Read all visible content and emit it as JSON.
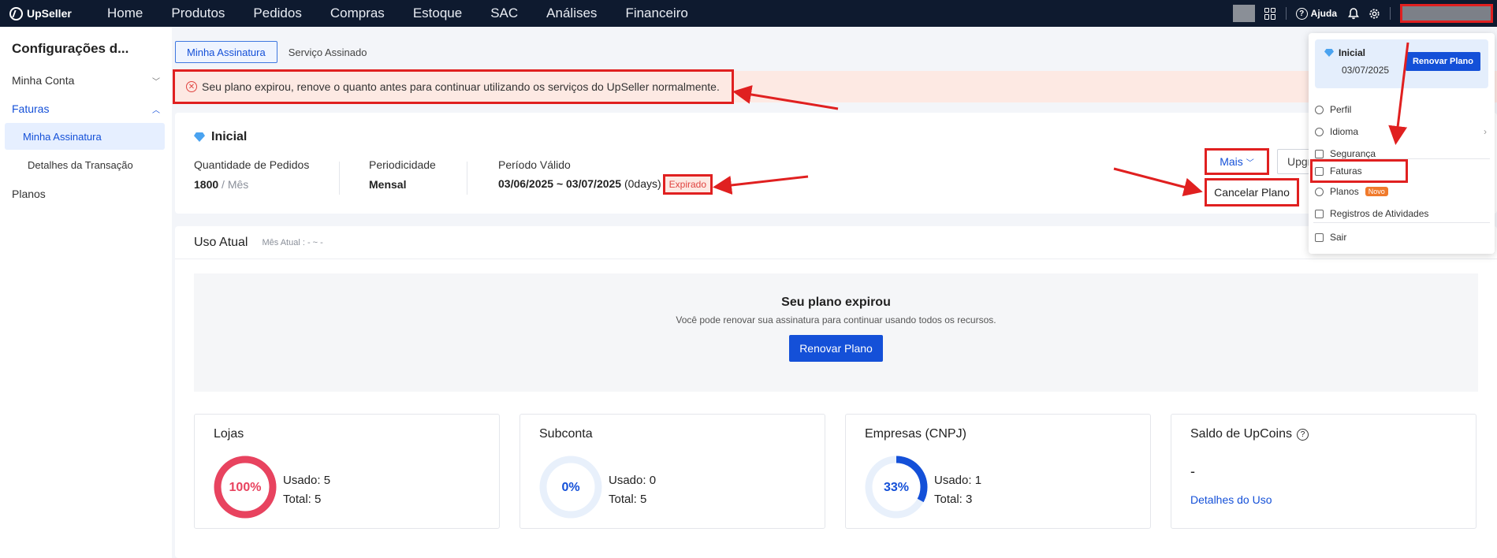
{
  "app": {
    "name": "UpSeller"
  },
  "nav": {
    "items": [
      "Home",
      "Produtos",
      "Pedidos",
      "Compras",
      "Estoque",
      "SAC",
      "Análises",
      "Financeiro"
    ]
  },
  "topbar": {
    "help_label": "Ajuda"
  },
  "sidebar": {
    "title": "Configurações d...",
    "minha_conta": "Minha Conta",
    "faturas": "Faturas",
    "minha_assinatura": "Minha Assinatura",
    "detalhes_transacao": "Detalhes da Transação",
    "planos": "Planos"
  },
  "tabs": {
    "active": "Minha Assinatura",
    "other": "Serviço Assinado"
  },
  "alert": {
    "text": "Seu plano expirou, renove o quanto antes para continuar utilizando os serviços do UpSeller normalmente."
  },
  "plan": {
    "name": "Inicial",
    "qty_label": "Quantidade de Pedidos",
    "qty_value": "1800",
    "qty_unit": " / Mês",
    "period_label": "Periodicidade",
    "period_value": "Mensal",
    "valid_label": "Período Válido",
    "valid_value": "03/06/2025 ~ 03/07/2025",
    "valid_days": " (0days)",
    "status_badge": "Expirado",
    "more_button": "Mais",
    "upgrade_button": "Upgrade",
    "cancel_option": "Cancelar Plano"
  },
  "usage": {
    "title": "Uso Atual",
    "month_label": "Mês Atual : - ~ -",
    "expired_title": "Seu plano expirou",
    "expired_sub": "Você pode renovar sua assinatura para continuar usando todos os recursos.",
    "renew_button": "Renovar Plano"
  },
  "cards": {
    "lojas": {
      "title": "Lojas",
      "percent_label": "100%",
      "percent": 1.0,
      "used": "Usado: 5",
      "total": "Total: 5",
      "color": "#e8435f"
    },
    "subconta": {
      "title": "Subconta",
      "percent_label": "0%",
      "percent": 0.0,
      "used": "Usado: 0",
      "total": "Total: 5",
      "color": "#1450d8"
    },
    "empresas": {
      "title": "Empresas (CNPJ)",
      "percent_label": "33%",
      "percent": 0.33,
      "used": "Usado: 1",
      "total": "Total: 3",
      "color": "#1450d8"
    },
    "upcoins": {
      "title": "Saldo de UpCoins",
      "value": "-",
      "link": "Detalhes do Uso"
    }
  },
  "dropdown": {
    "plan_name": "Inicial",
    "plan_date": "03/07/2025",
    "renew": "Renovar Plano",
    "perfil": "Perfil",
    "idioma": "Idioma",
    "seguranca": "Segurança",
    "faturas": "Faturas",
    "planos": "Planos",
    "novo": "Novo",
    "registros": "Registros de Atividades",
    "sair": "Sair"
  },
  "colors": {
    "brand": "#1450d8",
    "topbar": "#0e1a2f",
    "annotation": "#e02020",
    "error": "#e0433f"
  }
}
